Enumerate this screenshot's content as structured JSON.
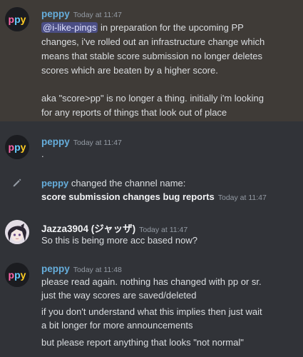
{
  "messages": [
    {
      "author": "peppy",
      "timestamp": "Today at 11:47",
      "mention": "@i-like-pings",
      "lines": [
        " in preparation for the upcoming PP",
        "changes, i've rolled out an infrastructure change which",
        "means that stable score submission no longer deletes",
        "scores which are beaten by a higher score.",
        "aka \"score>pp\" is no longer a thing. initially i'm looking",
        "for any reports of things that look out of place"
      ]
    },
    {
      "author": "peppy",
      "timestamp": "Today at 11:47",
      "lines": [
        "."
      ]
    },
    {
      "system_author": "peppy",
      "system_text": " changed the channel name:",
      "channel_name": "score submission changes bug reports",
      "timestamp": "Today at 11:47"
    },
    {
      "author": "Jazza3904 (ジャッザ)",
      "timestamp": "Today at 11:47",
      "lines": [
        "So this is being more acc based now?"
      ]
    },
    {
      "author": "peppy",
      "timestamp": "Today at 11:48",
      "lines": [
        "please read again. nothing has changed with pp or sr.",
        "just the way scores are saved/deleted",
        "if you don't understand what this implies then just wait",
        "a bit longer for more announcements",
        "but please report anything that looks \"not normal\""
      ]
    }
  ],
  "colors": {
    "background": "#313338",
    "highlight": "#3f3b37",
    "peppy_name": "#66aedc",
    "mention_bg": "#4b4e84"
  },
  "icons": {
    "avatar_peppy": "ppy-logo-avatar",
    "avatar_jazza": "anime-character-avatar",
    "system": "pencil-icon"
  }
}
